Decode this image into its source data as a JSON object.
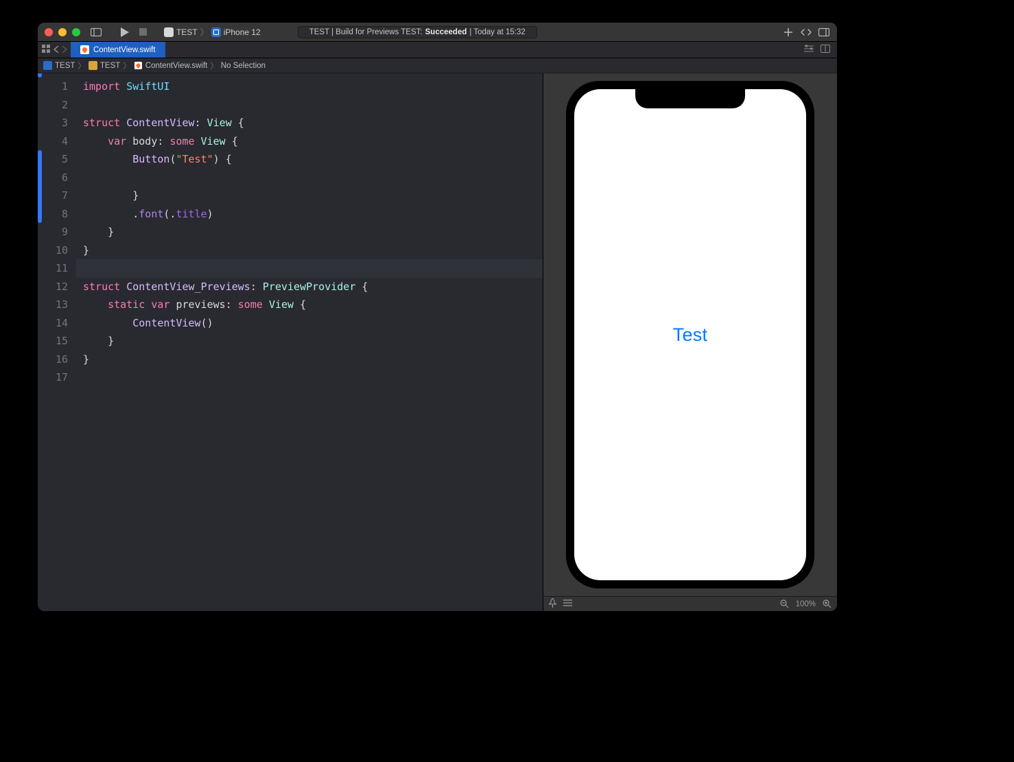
{
  "toolbar": {
    "scheme_name": "TEST",
    "device_name": "iPhone 12",
    "activity_prefix": "TEST | Build for Previews TEST: ",
    "activity_status": "Succeeded",
    "activity_time": " | Today at 15:32"
  },
  "tab": {
    "filename": "ContentView.swift"
  },
  "pathbar": {
    "project": "TEST",
    "folder": "TEST",
    "file": "ContentView.swift",
    "selection": "No Selection"
  },
  "editor": {
    "line_count": 17,
    "current_line": 11,
    "change_bars": [
      {
        "start": 5,
        "end": 8
      }
    ],
    "code_lines": [
      [
        {
          "cls": "kw",
          "t": "import"
        },
        {
          "cls": "",
          "t": " "
        },
        {
          "cls": "ident",
          "t": "SwiftUI"
        }
      ],
      [],
      [
        {
          "cls": "kw",
          "t": "struct"
        },
        {
          "cls": "",
          "t": " "
        },
        {
          "cls": "type",
          "t": "ContentView"
        },
        {
          "cls": "",
          "t": ": "
        },
        {
          "cls": "protocol",
          "t": "View"
        },
        {
          "cls": "",
          "t": " {"
        }
      ],
      [
        {
          "cls": "",
          "t": "    "
        },
        {
          "cls": "kw",
          "t": "var"
        },
        {
          "cls": "",
          "t": " body: "
        },
        {
          "cls": "kw",
          "t": "some"
        },
        {
          "cls": "",
          "t": " "
        },
        {
          "cls": "protocol",
          "t": "View"
        },
        {
          "cls": "",
          "t": " {"
        }
      ],
      [
        {
          "cls": "",
          "t": "        "
        },
        {
          "cls": "type",
          "t": "Button"
        },
        {
          "cls": "",
          "t": "("
        },
        {
          "cls": "str",
          "t": "\"Test\""
        },
        {
          "cls": "",
          "t": ") {"
        }
      ],
      [
        {
          "cls": "",
          "t": "            "
        }
      ],
      [
        {
          "cls": "",
          "t": "        }"
        }
      ],
      [
        {
          "cls": "",
          "t": "        ."
        },
        {
          "cls": "func",
          "t": "font"
        },
        {
          "cls": "",
          "t": "(."
        },
        {
          "cls": "member",
          "t": "title"
        },
        {
          "cls": "",
          "t": ")"
        }
      ],
      [
        {
          "cls": "",
          "t": "    }"
        }
      ],
      [
        {
          "cls": "",
          "t": "}"
        }
      ],
      [],
      [
        {
          "cls": "kw",
          "t": "struct"
        },
        {
          "cls": "",
          "t": " "
        },
        {
          "cls": "type",
          "t": "ContentView_Previews"
        },
        {
          "cls": "",
          "t": ": "
        },
        {
          "cls": "protocol",
          "t": "PreviewProvider"
        },
        {
          "cls": "",
          "t": " {"
        }
      ],
      [
        {
          "cls": "",
          "t": "    "
        },
        {
          "cls": "kw",
          "t": "static"
        },
        {
          "cls": "",
          "t": " "
        },
        {
          "cls": "kw",
          "t": "var"
        },
        {
          "cls": "",
          "t": " previews: "
        },
        {
          "cls": "kw",
          "t": "some"
        },
        {
          "cls": "",
          "t": " "
        },
        {
          "cls": "protocol",
          "t": "View"
        },
        {
          "cls": "",
          "t": " {"
        }
      ],
      [
        {
          "cls": "",
          "t": "        "
        },
        {
          "cls": "type",
          "t": "ContentView"
        },
        {
          "cls": "",
          "t": "()"
        }
      ],
      [
        {
          "cls": "",
          "t": "    }"
        }
      ],
      [
        {
          "cls": "",
          "t": "}"
        }
      ],
      []
    ]
  },
  "preview": {
    "button_text": "Test",
    "zoom_label": "100%"
  }
}
